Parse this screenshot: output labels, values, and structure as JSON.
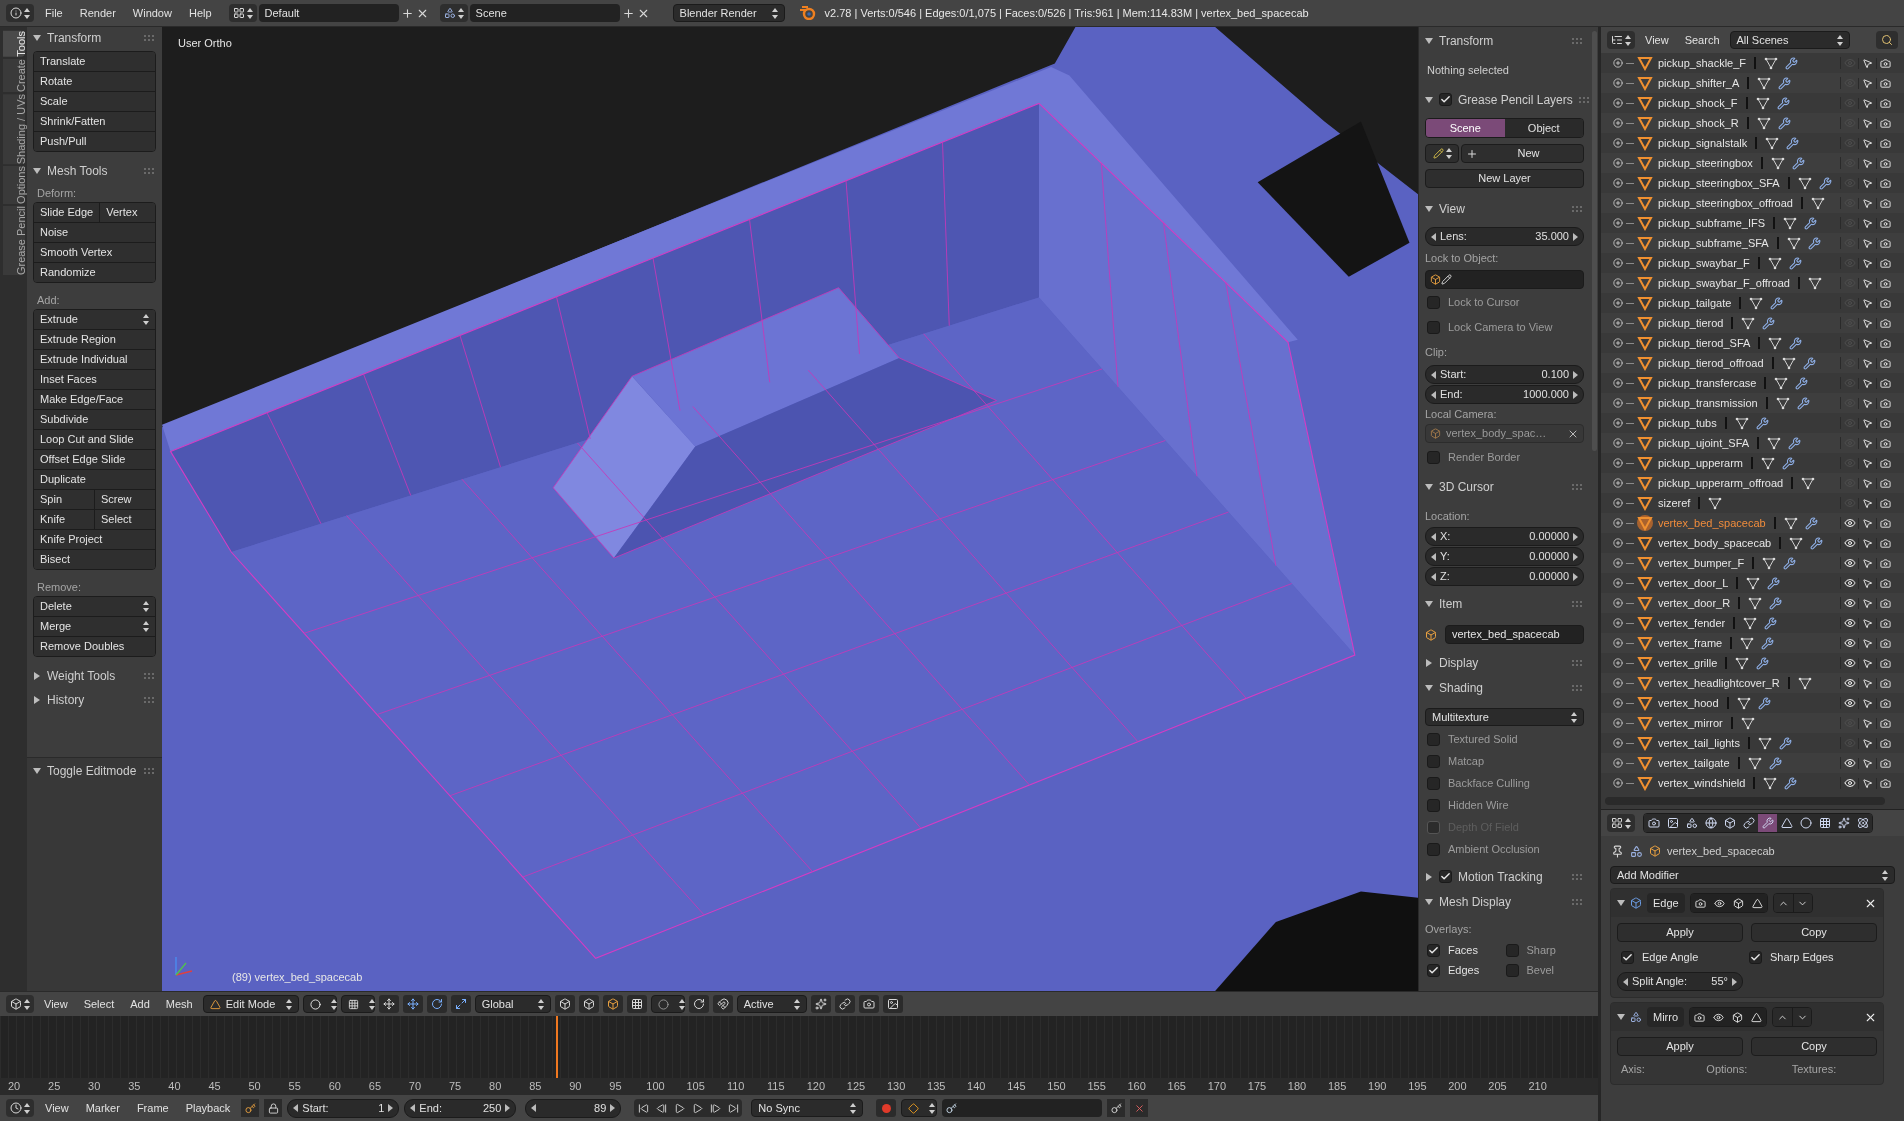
{
  "top_bar": {
    "menus": [
      "File",
      "Render",
      "Window",
      "Help"
    ],
    "screen_layout": "Default",
    "scene": "Scene",
    "render_engine": "Blender Render",
    "stats": "v2.78 | Verts:0/546 | Edges:0/1,075 | Faces:0/526 | Tris:961 | Mem:114.83M | vertex_bed_spacecab"
  },
  "tool_tabs": [
    {
      "label": "Tools",
      "selected": true
    },
    {
      "label": "Create",
      "selected": false
    },
    {
      "label": "Shading / UVs",
      "selected": false
    },
    {
      "label": "Options",
      "selected": false
    },
    {
      "label": "Grease Pencil",
      "selected": false
    }
  ],
  "tool_shelf": {
    "panels": [
      {
        "title": "Transform",
        "expanded": true,
        "groups": [
          {
            "rows": [
              {
                "kind": "button",
                "labels": [
                  "Translate"
                ]
              },
              {
                "kind": "button",
                "labels": [
                  "Rotate"
                ]
              },
              {
                "kind": "button",
                "labels": [
                  "Scale"
                ]
              },
              {
                "kind": "button",
                "labels": [
                  "Shrink/Fatten"
                ]
              },
              {
                "kind": "button",
                "labels": [
                  "Push/Pull"
                ]
              }
            ]
          }
        ]
      },
      {
        "title": "Mesh Tools",
        "expanded": true,
        "groups": [
          {
            "label": "Deform:",
            "rows": [
              {
                "kind": "button",
                "labels": [
                  "Slide Edge",
                  "Vertex"
                ]
              },
              {
                "kind": "button",
                "labels": [
                  "Noise"
                ]
              },
              {
                "kind": "button",
                "labels": [
                  "Smooth Vertex"
                ]
              },
              {
                "kind": "button",
                "labels": [
                  "Randomize"
                ]
              }
            ]
          },
          {
            "label": "Add:",
            "rows": [
              {
                "kind": "dropdown",
                "labels": [
                  "Extrude"
                ]
              },
              {
                "kind": "button",
                "labels": [
                  "Extrude Region"
                ]
              },
              {
                "kind": "button",
                "labels": [
                  "Extrude Individual"
                ]
              },
              {
                "kind": "button",
                "labels": [
                  "Inset Faces"
                ]
              },
              {
                "kind": "button",
                "labels": [
                  "Make Edge/Face"
                ]
              },
              {
                "kind": "button",
                "labels": [
                  "Subdivide"
                ]
              },
              {
                "kind": "button",
                "labels": [
                  "Loop Cut and Slide"
                ]
              },
              {
                "kind": "button",
                "labels": [
                  "Offset Edge Slide"
                ]
              },
              {
                "kind": "button",
                "labels": [
                  "Duplicate"
                ]
              },
              {
                "kind": "button",
                "labels": [
                  "Spin",
                  "Screw"
                ]
              },
              {
                "kind": "button",
                "labels": [
                  "Knife",
                  "Select"
                ]
              },
              {
                "kind": "button",
                "labels": [
                  "Knife Project"
                ]
              },
              {
                "kind": "button",
                "labels": [
                  "Bisect"
                ]
              }
            ]
          },
          {
            "label": "Remove:",
            "rows": [
              {
                "kind": "dropdown",
                "labels": [
                  "Delete"
                ]
              },
              {
                "kind": "dropdown",
                "labels": [
                  "Merge"
                ]
              },
              {
                "kind": "button",
                "labels": [
                  "Remove Doubles"
                ]
              }
            ]
          }
        ]
      },
      {
        "title": "Weight Tools",
        "expanded": false
      },
      {
        "title": "History",
        "expanded": false
      }
    ],
    "operator_panel": {
      "title": "Toggle Editmode",
      "expanded": true
    }
  },
  "viewport": {
    "view_name": "User Ortho",
    "object_info": "(89) vertex_bed_spacecab"
  },
  "n_panel": {
    "transform": {
      "title": "Transform",
      "expanded": true,
      "note": "Nothing selected"
    },
    "grease_pencil": {
      "title": "Grease Pencil Layers",
      "expanded": true,
      "checked": true,
      "tabs": [
        {
          "label": "Scene",
          "selected": true
        },
        {
          "label": "Object",
          "selected": false
        }
      ],
      "new_button": "New",
      "new_layer_button": "New Layer"
    },
    "view": {
      "title": "View",
      "expanded": true,
      "lens": {
        "label": "Lens:",
        "value": "35.000"
      },
      "lock_label": "Lock to Object:",
      "lock_options": [
        {
          "label": "Lock to Cursor",
          "checked": false
        },
        {
          "label": "Lock Camera to View",
          "checked": false
        }
      ],
      "clip_label": "Clip:",
      "clip": [
        {
          "label": "Start:",
          "value": "0.100"
        },
        {
          "label": "End:",
          "value": "1000.000"
        }
      ],
      "local_camera_label": "Local Camera:",
      "local_camera": "vertex_body_spac…",
      "render_border": {
        "label": "Render Border",
        "checked": false
      }
    },
    "cursor": {
      "title": "3D Cursor",
      "expanded": true,
      "location_label": "Location:",
      "fields": [
        {
          "label": "X:",
          "value": "0.00000"
        },
        {
          "label": "Y:",
          "value": "0.00000"
        },
        {
          "label": "Z:",
          "value": "0.00000"
        }
      ]
    },
    "item": {
      "title": "Item",
      "expanded": true,
      "name": "vertex_bed_spacecab"
    },
    "display": {
      "title": "Display",
      "expanded": false
    },
    "shading": {
      "title": "Shading",
      "expanded": true,
      "mode": "Multitexture",
      "options": [
        {
          "label": "Textured Solid",
          "checked": false,
          "disabled": false
        },
        {
          "label": "Matcap",
          "checked": false,
          "disabled": false
        },
        {
          "label": "Backface Culling",
          "checked": false,
          "disabled": false
        },
        {
          "label": "Hidden Wire",
          "checked": false,
          "disabled": false
        },
        {
          "label": "Depth Of Field",
          "checked": false,
          "disabled": true
        },
        {
          "label": "Ambient Occlusion",
          "checked": false,
          "disabled": false
        }
      ]
    },
    "motion_tracking": {
      "title": "Motion Tracking",
      "expanded": false,
      "checked": true
    },
    "mesh_display": {
      "title": "Mesh Display",
      "expanded": true,
      "overlays_label": "Overlays:",
      "overlays": [
        {
          "label": "Faces",
          "checked": true
        },
        {
          "label": "Sharp",
          "checked": false
        },
        {
          "label": "Edges",
          "checked": true
        },
        {
          "label": "Bevel",
          "checked": false
        }
      ]
    }
  },
  "outliner": {
    "menus": [
      "View",
      "Search"
    ],
    "scenes": "All Scenes",
    "items": [
      {
        "name": "pickup_shackle_F",
        "selected": false,
        "visible": false,
        "modifier": true
      },
      {
        "name": "pickup_shifter_A",
        "selected": false,
        "visible": false,
        "modifier": true
      },
      {
        "name": "pickup_shock_F",
        "selected": false,
        "visible": false,
        "modifier": true
      },
      {
        "name": "pickup_shock_R",
        "selected": false,
        "visible": false,
        "modifier": true
      },
      {
        "name": "pickup_signalstalk",
        "selected": false,
        "visible": false,
        "modifier": true
      },
      {
        "name": "pickup_steeringbox",
        "selected": false,
        "visible": false,
        "modifier": true
      },
      {
        "name": "pickup_steeringbox_SFA",
        "selected": false,
        "visible": false,
        "modifier": true
      },
      {
        "name": "pickup_steeringbox_offroad",
        "selected": false,
        "visible": false,
        "modifier": false
      },
      {
        "name": "pickup_subframe_IFS",
        "selected": false,
        "visible": false,
        "modifier": true
      },
      {
        "name": "pickup_subframe_SFA",
        "selected": false,
        "visible": false,
        "modifier": true
      },
      {
        "name": "pickup_swaybar_F",
        "selected": false,
        "visible": false,
        "modifier": true
      },
      {
        "name": "pickup_swaybar_F_offroad",
        "selected": false,
        "visible": false,
        "modifier": false
      },
      {
        "name": "pickup_tailgate",
        "selected": false,
        "visible": false,
        "modifier": true
      },
      {
        "name": "pickup_tierod",
        "selected": false,
        "visible": false,
        "modifier": true
      },
      {
        "name": "pickup_tierod_SFA",
        "selected": false,
        "visible": false,
        "modifier": true
      },
      {
        "name": "pickup_tierod_offroad",
        "selected": false,
        "visible": false,
        "modifier": true
      },
      {
        "name": "pickup_transfercase",
        "selected": false,
        "visible": false,
        "modifier": true
      },
      {
        "name": "pickup_transmission",
        "selected": false,
        "visible": false,
        "modifier": true
      },
      {
        "name": "pickup_tubs",
        "selected": false,
        "visible": false,
        "modifier": true
      },
      {
        "name": "pickup_ujoint_SFA",
        "selected": false,
        "visible": false,
        "modifier": true
      },
      {
        "name": "pickup_upperarm",
        "selected": false,
        "visible": false,
        "modifier": true
      },
      {
        "name": "pickup_upperarm_offroad",
        "selected": false,
        "visible": false,
        "modifier": false
      },
      {
        "name": "sizeref",
        "selected": false,
        "visible": false,
        "modifier": false
      },
      {
        "name": "vertex_bed_spacecab",
        "selected": true,
        "visible": true,
        "modifier": true
      },
      {
        "name": "vertex_body_spacecab",
        "selected": false,
        "visible": true,
        "modifier": true
      },
      {
        "name": "vertex_bumper_F",
        "selected": false,
        "visible": true,
        "modifier": true
      },
      {
        "name": "vertex_door_L",
        "selected": false,
        "visible": true,
        "modifier": true
      },
      {
        "name": "vertex_door_R",
        "selected": false,
        "visible": true,
        "modifier": true
      },
      {
        "name": "vertex_fender",
        "selected": false,
        "visible": true,
        "modifier": true
      },
      {
        "name": "vertex_frame",
        "selected": false,
        "visible": true,
        "modifier": true
      },
      {
        "name": "vertex_grille",
        "selected": false,
        "visible": true,
        "modifier": true
      },
      {
        "name": "vertex_headlightcover_R",
        "selected": false,
        "visible": true,
        "modifier": false
      },
      {
        "name": "vertex_hood",
        "selected": false,
        "visible": true,
        "modifier": true
      },
      {
        "name": "vertex_mirror",
        "selected": false,
        "visible": false,
        "modifier": false
      },
      {
        "name": "vertex_tail_lights",
        "selected": false,
        "visible": false,
        "modifier": true
      },
      {
        "name": "vertex_tailgate",
        "selected": false,
        "visible": true,
        "modifier": true
      },
      {
        "name": "vertex_windshield",
        "selected": false,
        "visible": true,
        "modifier": true
      }
    ]
  },
  "properties": {
    "tabs": [
      {
        "kind": "render",
        "selected": false
      },
      {
        "kind": "layers",
        "selected": false
      },
      {
        "kind": "scene",
        "selected": false
      },
      {
        "kind": "world",
        "selected": false
      },
      {
        "kind": "object",
        "selected": false
      },
      {
        "kind": "constraints",
        "selected": false
      },
      {
        "kind": "modifiers",
        "selected": true
      },
      {
        "kind": "data",
        "selected": false
      },
      {
        "kind": "material",
        "selected": false
      },
      {
        "kind": "texture",
        "selected": false
      },
      {
        "kind": "particles",
        "selected": false
      },
      {
        "kind": "physics",
        "selected": false
      }
    ],
    "object": "vertex_bed_spacecab",
    "add_modifier": "Add Modifier",
    "modifiers": [
      {
        "kind": "edge_split",
        "name": "Edge",
        "expanded": true,
        "apply": "Apply",
        "copy": "Copy",
        "options": [
          {
            "label": "Edge Angle",
            "checked": true
          },
          {
            "label": "Sharp Edges",
            "checked": true
          }
        ],
        "split_angle": {
          "label": "Split Angle:",
          "value": "55°"
        }
      },
      {
        "kind": "mirror",
        "name": "Mirro",
        "expanded": true,
        "apply": "Apply",
        "copy": "Copy",
        "columns": [
          "Axis:",
          "Options:",
          "Textures:"
        ]
      }
    ]
  },
  "viewport_header": {
    "menus": [
      "View",
      "Select",
      "Add",
      "Mesh"
    ],
    "mode": "Edit Mode",
    "orientation": "Global",
    "snap_target": "Active"
  },
  "timeline": {
    "ticks": [
      "20",
      "25",
      "30",
      "35",
      "40",
      "45",
      "50",
      "55",
      "60",
      "65",
      "70",
      "75",
      "80",
      "85",
      "90",
      "95",
      "100",
      "105",
      "110",
      "115",
      "120",
      "125",
      "130",
      "135",
      "140",
      "145",
      "150",
      "155",
      "160",
      "165",
      "170",
      "175",
      "180",
      "185",
      "190",
      "195",
      "200",
      "205",
      "210"
    ],
    "playhead": {
      "level": 0.348
    }
  },
  "timeline_header": {
    "menus": [
      "View",
      "Marker",
      "Frame",
      "Playback"
    ],
    "start": {
      "label": "Start:",
      "value": "1"
    },
    "end": {
      "label": "End:",
      "value": "250"
    },
    "current": {
      "value": "89"
    },
    "sync": "No Sync"
  }
}
